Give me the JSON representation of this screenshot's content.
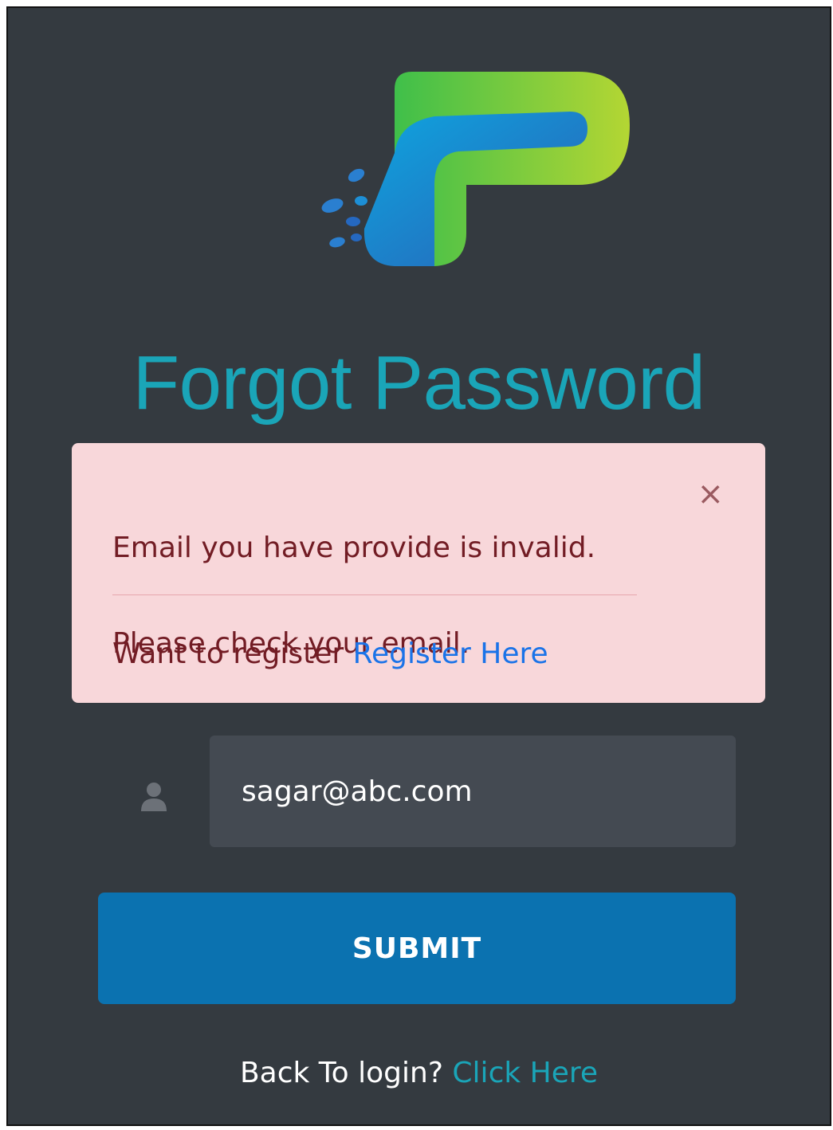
{
  "page": {
    "title": "Forgot Password"
  },
  "logo": {
    "icon": "brand-p-logo",
    "colors": [
      "#7ccf3a",
      "#0aa3e0",
      "#2a6fbf"
    ]
  },
  "alert": {
    "message_line1": "Email you have provide is invalid.",
    "message_line2": "Please check your email.",
    "close_symbol": "×",
    "register_prompt": "Want to register",
    "register_link": "Register Here",
    "background": "#f8d7da",
    "text_color": "#721c24"
  },
  "form": {
    "user_icon": "user-icon",
    "email_value": "sagar@abc.com",
    "submit_label": "SUBMIT"
  },
  "footer": {
    "back_prompt": "Back To login?",
    "back_link": "Click Here"
  },
  "theme": {
    "background": "#343a40",
    "accent": "#1aa5b8",
    "button": "#0b72b0",
    "link": "#1a73e8"
  }
}
